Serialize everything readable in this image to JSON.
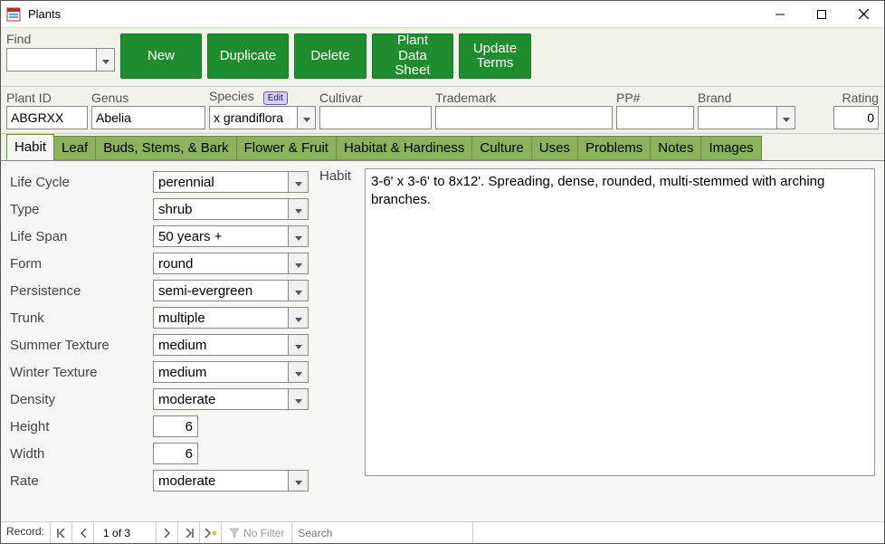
{
  "window": {
    "title": "Plants"
  },
  "find": {
    "label": "Find",
    "value": ""
  },
  "toolbar": {
    "new": "New",
    "duplicate": "Duplicate",
    "delete": "Delete",
    "datasheet": "Plant Data Sheet",
    "updateterms": "Update Terms"
  },
  "fields": {
    "plantid": {
      "label": "Plant ID",
      "value": "ABGRXX"
    },
    "genus": {
      "label": "Genus",
      "value": "Abelia"
    },
    "species": {
      "label": "Species",
      "edit_label": "Edit",
      "value": "x grandiflora"
    },
    "cultivar": {
      "label": "Cultivar",
      "value": ""
    },
    "trademark": {
      "label": "Trademark",
      "value": ""
    },
    "pp": {
      "label": "PP#",
      "value": ""
    },
    "brand": {
      "label": "Brand",
      "value": ""
    },
    "rating": {
      "label": "Rating",
      "value": "0"
    }
  },
  "tabs": [
    "Habit",
    "Leaf",
    "Buds, Stems, & Bark",
    "Flower & Fruit",
    "Habitat & Hardiness",
    "Culture",
    "Uses",
    "Problems",
    "Notes",
    "Images"
  ],
  "habit": {
    "life_cycle": {
      "label": "Life Cycle",
      "value": "perennial"
    },
    "type": {
      "label": "Type",
      "value": "shrub"
    },
    "life_span": {
      "label": "Life Span",
      "value": "50 years +"
    },
    "form": {
      "label": "Form",
      "value": "round"
    },
    "persistence": {
      "label": "Persistence",
      "value": "semi-evergreen"
    },
    "trunk": {
      "label": "Trunk",
      "value": "multiple"
    },
    "summer_texture": {
      "label": "Summer Texture",
      "value": "medium"
    },
    "winter_texture": {
      "label": "Winter Texture",
      "value": "medium"
    },
    "density": {
      "label": "Density",
      "value": "moderate"
    },
    "height": {
      "label": "Height",
      "value": "6"
    },
    "width": {
      "label": "Width",
      "value": "6"
    },
    "rate": {
      "label": "Rate",
      "value": "moderate"
    },
    "desc_label": "Habit",
    "desc": "3-6' x 3-6' to 8x12'. Spreading, dense, rounded, multi-stemmed with arching branches."
  },
  "recordnav": {
    "label": "Record:",
    "position": "1 of 3",
    "nofilter": "No Filter",
    "search_placeholder": "Search"
  }
}
